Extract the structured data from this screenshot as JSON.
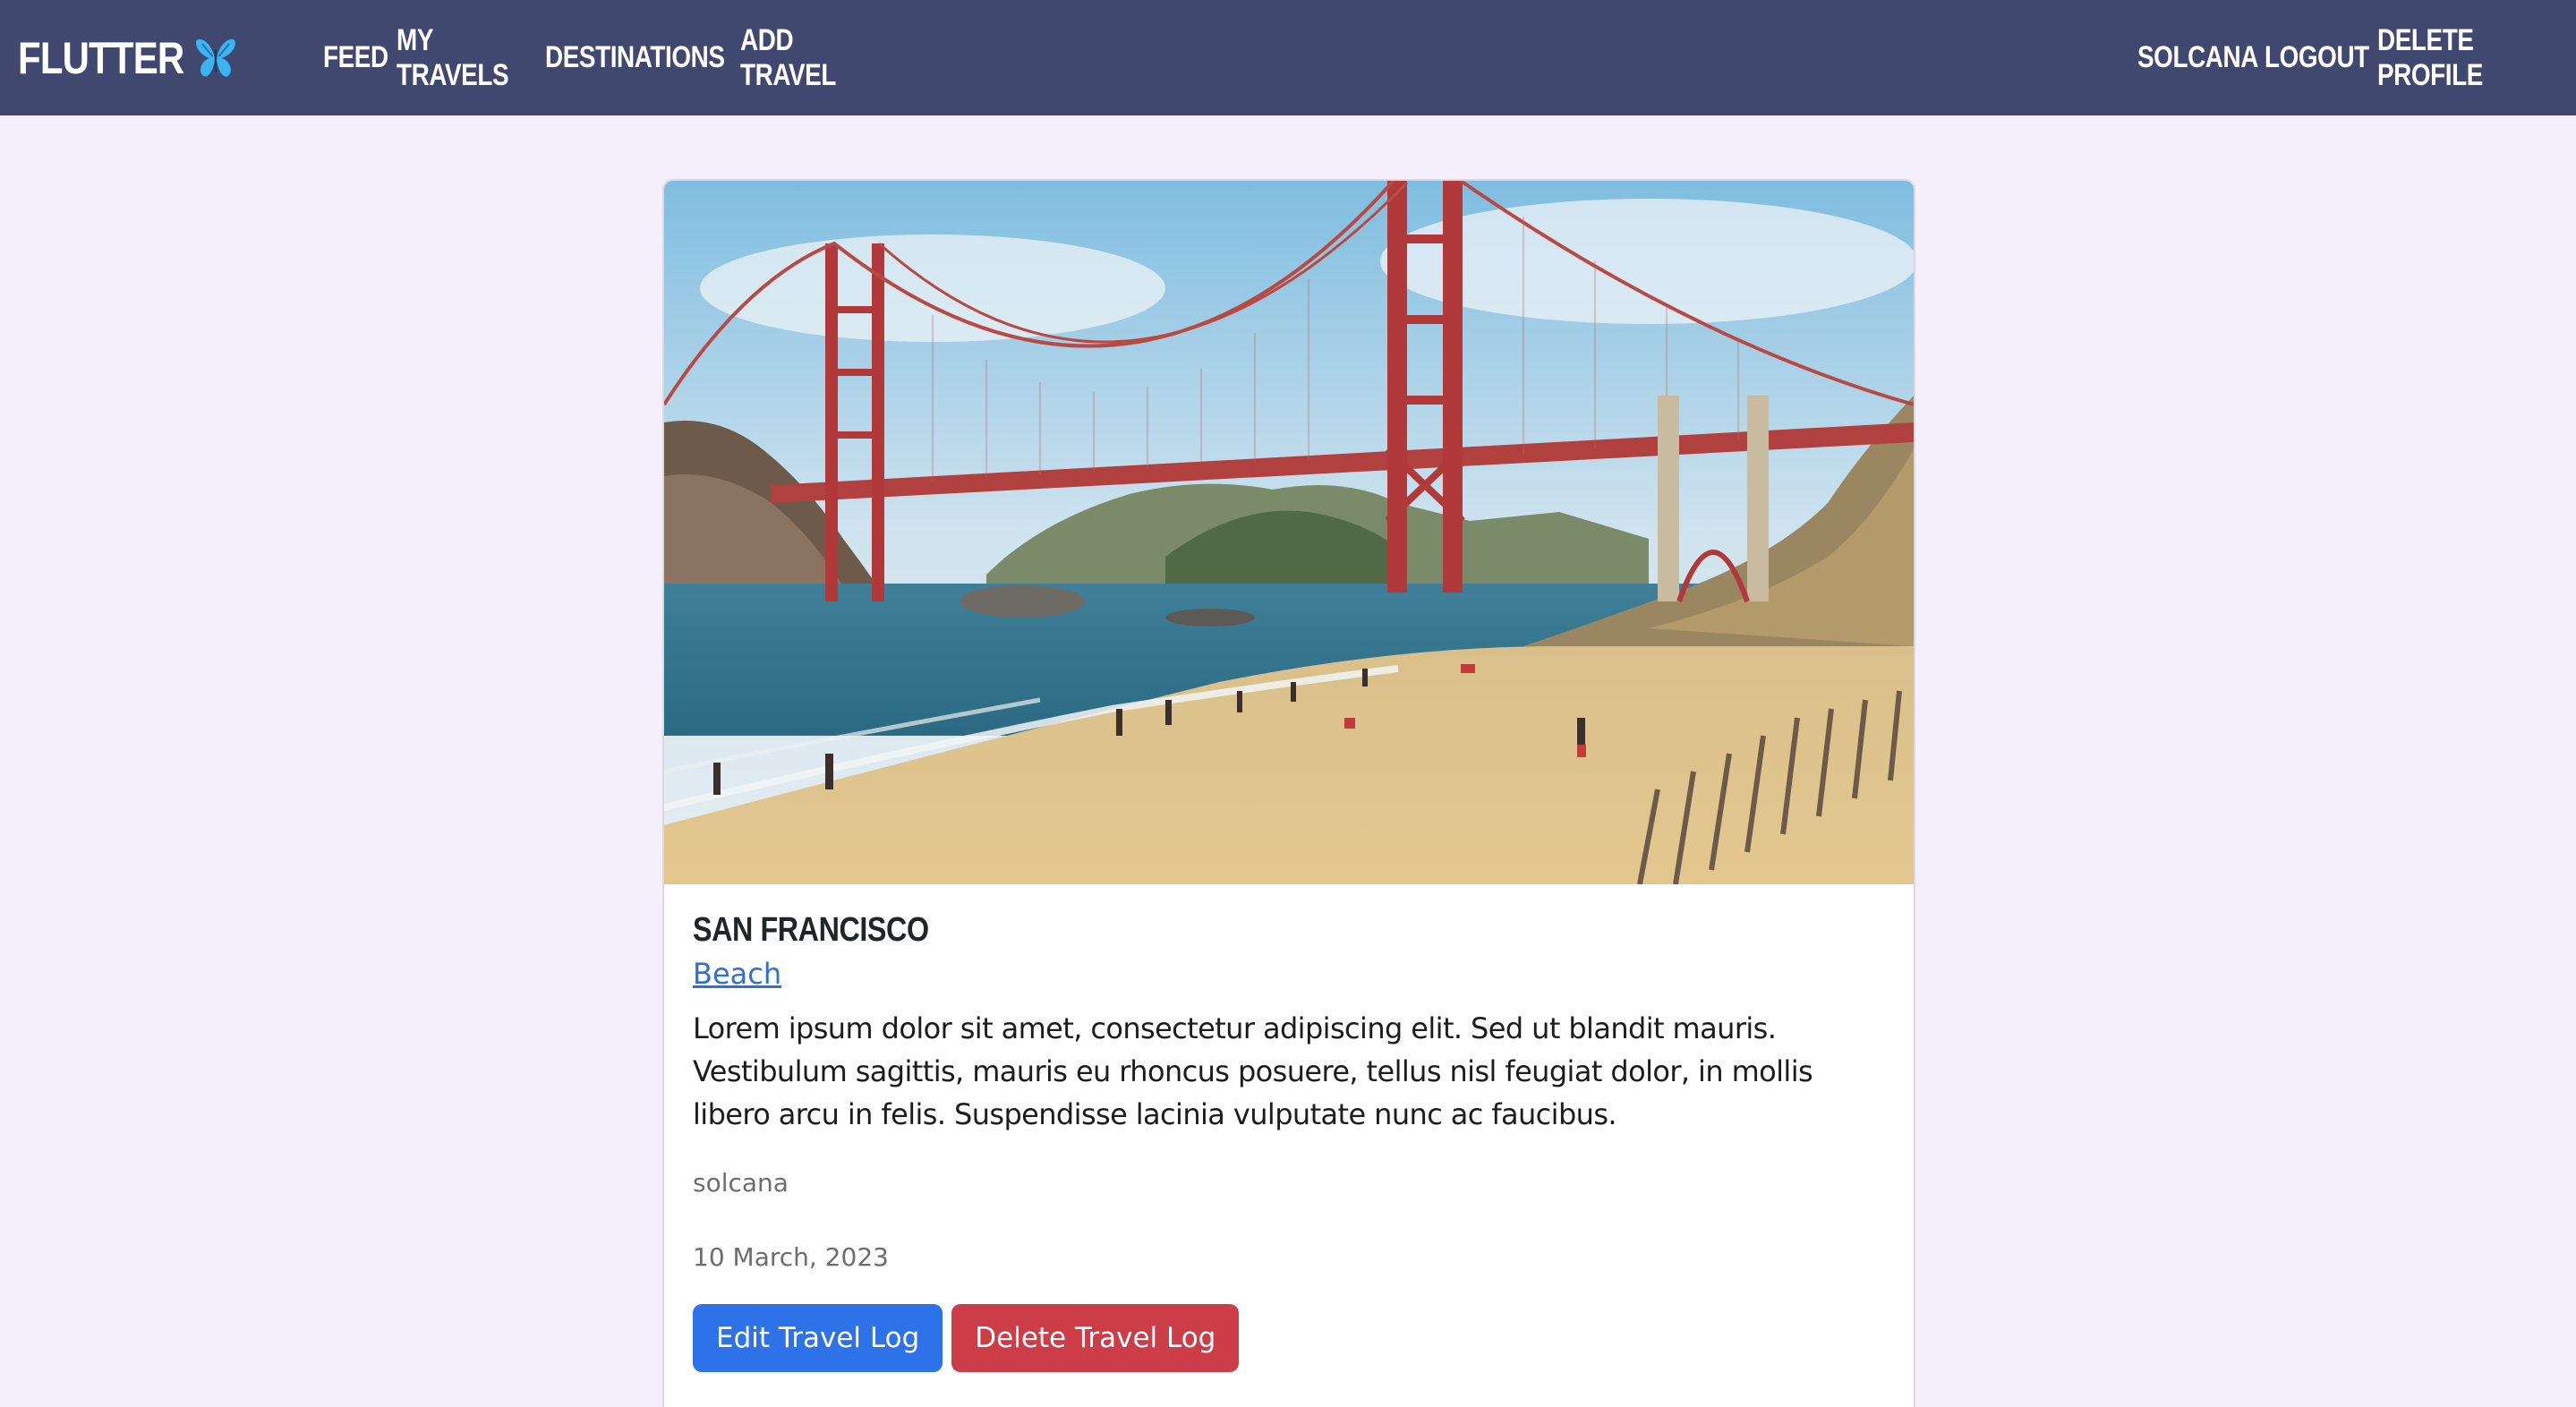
{
  "navbar": {
    "brand": "FLUTTER",
    "brand_icon": "butterfly-icon",
    "links_left": [
      "FEED",
      "MY TRAVELS",
      "DESTINATIONS",
      "ADD TRAVEL"
    ],
    "links_right": [
      "SOLCANA",
      "LOGOUT",
      "DELETE PROFILE"
    ],
    "background": "#404870"
  },
  "card": {
    "image_icon": "golden-gate-bridge-beach-photo",
    "title": "SAN FRANCISCO",
    "category": "Beach",
    "description": "Lorem ipsum dolor sit amet, consectetur adipiscing elit. Sed ut blandit mauris. Vestibulum sagittis, mauris eu rhoncus posuere, tellus nisl feugiat dolor, in mollis libero arcu in felis. Suspendisse lacinia vulputate nunc ac faucibus.",
    "author": "solcana",
    "date": "10 March, 2023",
    "edit_label": "Edit Travel Log",
    "delete_label": "Delete Travel Log"
  },
  "colors": {
    "page_bg": "#f5effd",
    "primary": "#2e72ea",
    "danger": "#cd3d48",
    "link": "#2f6fd6"
  }
}
